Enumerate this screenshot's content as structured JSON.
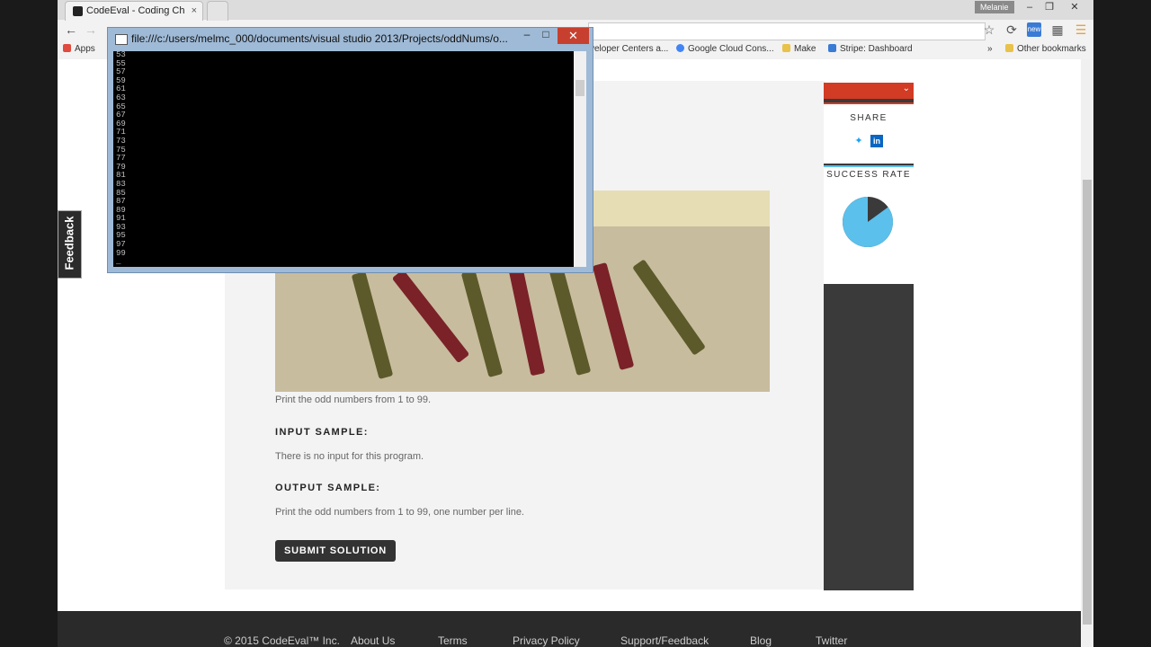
{
  "browser": {
    "tab_title": "CodeEval - Coding Challe",
    "tab_close": "×",
    "user_badge": "Melanie",
    "window_min": "–",
    "window_restore": "❐",
    "window_close": "✕",
    "ext_badge": "new",
    "bookmarks": [
      {
        "label": "Apps",
        "color": "#e04a3f"
      },
      {
        "label": "veloper Centers a...",
        "color": "#cfcfcf"
      },
      {
        "label": "Google Cloud Cons...",
        "color": "#4285f4"
      },
      {
        "label": "Make",
        "color": "#e8c24a"
      },
      {
        "label": "Stripe: Dashboard",
        "color": "#3a7bd5"
      },
      {
        "label": "»",
        "color": ""
      },
      {
        "label": "Other bookmarks",
        "color": "#e8c24a"
      }
    ]
  },
  "console": {
    "title": "file:///c:/users/melmc_000/documents/visual studio 2013/Projects/oddNums/o...",
    "min": "–",
    "max": "□",
    "close": "✕",
    "lines": [
      "53",
      "55",
      "57",
      "59",
      "61",
      "63",
      "65",
      "67",
      "69",
      "71",
      "73",
      "75",
      "77",
      "79",
      "81",
      "83",
      "85",
      "87",
      "89",
      "91",
      "93",
      "95",
      "97",
      "99",
      "_"
    ]
  },
  "challenge": {
    "description": "Print the odd numbers from 1 to 99.",
    "input_heading": "INPUT SAMPLE:",
    "input_text": "There is no input for this program.",
    "output_heading": "OUTPUT SAMPLE:",
    "output_text": "Print the odd numbers from 1 to 99, one number per line.",
    "submit_label": "SUBMIT SOLUTION"
  },
  "sidebar": {
    "share_heading": "SHARE",
    "success_heading": "SUCCESS RATE",
    "success_rate": 0.85,
    "colors": {
      "success": "#5bc0eb",
      "fail": "#3a3a3a"
    }
  },
  "feedback_tab": "Feedback",
  "footer": {
    "copyright": "© 2015 CodeEval™ Inc.",
    "links": [
      "About Us",
      "Terms",
      "Privacy Policy",
      "Support/Feedback",
      "Blog",
      "Twitter"
    ]
  }
}
